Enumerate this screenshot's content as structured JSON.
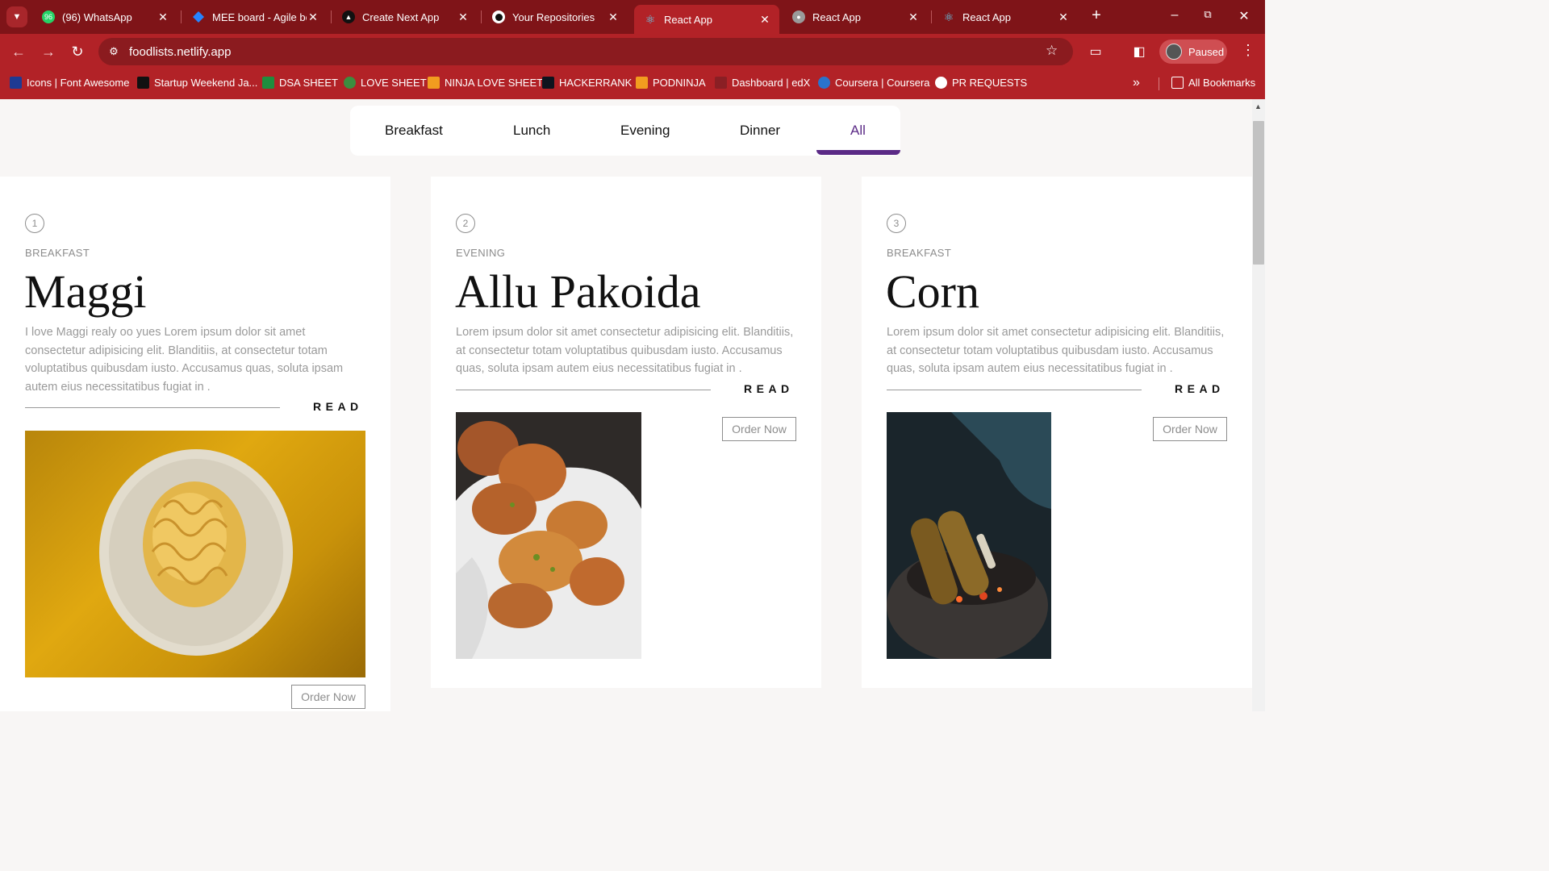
{
  "browser": {
    "tabs": [
      {
        "title": "(96) WhatsApp",
        "favicon": "whatsapp-icon",
        "badge": "96"
      },
      {
        "title": "MEE board - Agile bo",
        "favicon": "jira-icon"
      },
      {
        "title": "Create Next App",
        "favicon": "triangle-icon"
      },
      {
        "title": "Your Repositories",
        "favicon": "github-icon"
      },
      {
        "title": "React App",
        "favicon": "react-icon"
      },
      {
        "title": "React App",
        "favicon": "globe-icon"
      },
      {
        "title": "React App",
        "favicon": "react-icon"
      }
    ],
    "active_tab": 4,
    "url": "foodlists.netlify.app",
    "profile_label": "Paused",
    "bookmarks": [
      {
        "label": "Icons | Font Awesome",
        "icon": "flag-icon",
        "color": "#1f3a93"
      },
      {
        "label": "Startup Weekend Ja...",
        "icon": "startup-icon",
        "color": "#111111"
      },
      {
        "label": "DSA SHEET",
        "icon": "sheet-icon",
        "color": "#1e8e3e"
      },
      {
        "label": "LOVE SHEET",
        "icon": "leaf-icon",
        "color": "#3c8d3f"
      },
      {
        "label": "NINJA LOVE SHEET",
        "icon": "ninja-icon",
        "color": "#f29c1f"
      },
      {
        "label": "HACKERRANK",
        "icon": "hackerrank-icon",
        "color": "#0e141e"
      },
      {
        "label": "PODNINJA",
        "icon": "podninja-icon",
        "color": "#f29c1f"
      },
      {
        "label": "Dashboard | edX",
        "icon": "edx-icon",
        "color": "#8a1f24"
      },
      {
        "label": "Coursera | Coursera",
        "icon": "coursera-icon",
        "color": "#2a73cc"
      },
      {
        "label": "PR REQUESTS",
        "icon": "github-icon",
        "color": "#ffffff"
      }
    ],
    "all_bookmarks": "All Bookmarks",
    "colors": {
      "frame": "#7f1418",
      "toolbar": "#b22227",
      "omnibox": "#8b1b1f"
    }
  },
  "nav": {
    "items": [
      "Breakfast",
      "Lunch",
      "Evening",
      "Dinner",
      "All"
    ],
    "active": "All",
    "accent": "#5b2a86"
  },
  "cards": [
    {
      "number": "1",
      "category": "BREAKFAST",
      "title": "Maggi",
      "description": "I love Maggi realy oo yues Lorem ipsum dolor sit amet consectetur adipisicing elit. Blanditiis, at consectetur totam voluptatibus quibusdam iusto. Accusamus quas, soluta ipsam autem eius necessitatibus fugiat in .",
      "read_label": "READ",
      "order_label": "Order Now",
      "image": "maggi-noodles-photo"
    },
    {
      "number": "2",
      "category": "EVENING",
      "title": "Allu Pakoida",
      "description": "Lorem ipsum dolor sit amet consectetur adipisicing elit. Blanditiis, at consectetur totam voluptatibus quibusdam iusto. Accusamus quas, soluta ipsam autem eius necessitatibus fugiat in .",
      "read_label": "READ",
      "order_label": "Order Now",
      "image": "pakora-photo"
    },
    {
      "number": "3",
      "category": "BREAKFAST",
      "title": "Corn",
      "description": "Lorem ipsum dolor sit amet consectetur adipisicing elit. Blanditiis, at consectetur totam voluptatibus quibusdam iusto. Accusamus quas, soluta ipsam autem eius necessitatibus fugiat in .",
      "read_label": "READ",
      "order_label": "Order Now",
      "image": "roasted-corn-photo"
    }
  ]
}
